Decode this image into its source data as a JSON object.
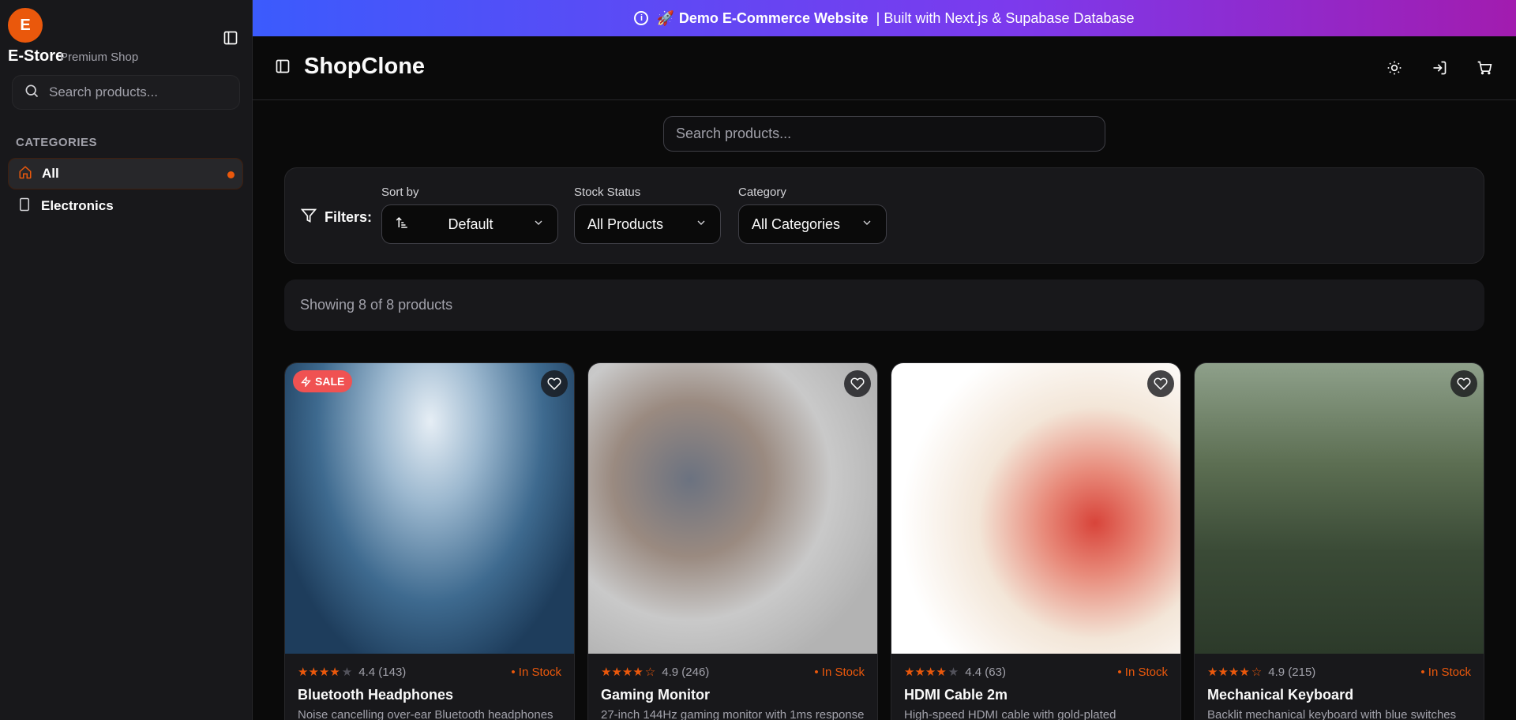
{
  "sidebar": {
    "logo_letter": "E",
    "brand_name": "E-Store",
    "brand_sub": "Premium Shop",
    "search_placeholder": "Search products...",
    "categories_label": "CATEGORIES",
    "categories": [
      {
        "label": "All",
        "icon": "home-icon",
        "active": true
      },
      {
        "label": "Electronics",
        "icon": "tablet-icon",
        "active": false
      }
    ]
  },
  "banner": {
    "emoji": "🚀",
    "title": "Demo E-Commerce Website",
    "subtitle": "| Built with Next.js & Supabase Database"
  },
  "header": {
    "title": "ShopClone"
  },
  "search": {
    "placeholder": "Search products..."
  },
  "filters": {
    "label": "Filters:",
    "sort_label": "Sort by",
    "sort_value": "Default",
    "stock_label": "Stock Status",
    "stock_value": "All Products",
    "category_label": "Category",
    "category_value": "All Categories"
  },
  "results": {
    "showing": "Showing 8 of 8 products"
  },
  "products": [
    {
      "name": "Bluetooth Headphones",
      "rating": "4.4 (143)",
      "stars": 4,
      "stock": "In Stock",
      "desc": "Noise cancelling over-ear Bluetooth headphones",
      "sale": "SALE"
    },
    {
      "name": "Gaming Monitor",
      "rating": "4.9 (246)",
      "stars": 4.5,
      "stock": "In Stock",
      "desc": "27-inch 144Hz gaming monitor with 1ms response"
    },
    {
      "name": "HDMI Cable 2m",
      "rating": "4.4 (63)",
      "stars": 4,
      "stock": "In Stock",
      "desc": "High-speed HDMI cable with gold-plated"
    },
    {
      "name": "Mechanical Keyboard",
      "rating": "4.9 (215)",
      "stars": 4.5,
      "stock": "In Stock",
      "desc": "Backlit mechanical keyboard with blue switches"
    }
  ],
  "colors": {
    "accent": "#ea580c",
    "sale": "#f05252",
    "background": "#0a0a0a",
    "surface": "#18181b"
  }
}
